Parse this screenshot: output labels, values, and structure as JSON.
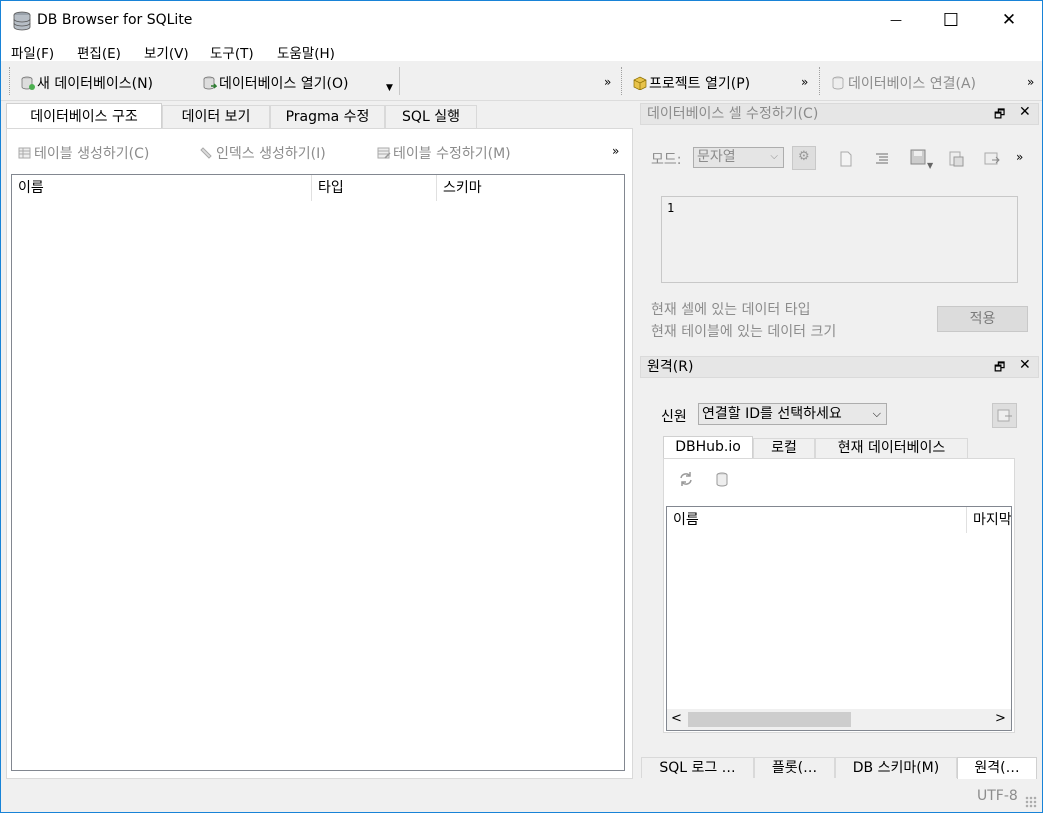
{
  "window": {
    "title": "DB Browser for SQLite",
    "minimize": "—",
    "maximize": "☐",
    "close": "✕"
  },
  "menu": [
    "파일(F)",
    "편집(E)",
    "보기(V)",
    "도구(T)",
    "도움말(H)"
  ],
  "toolbar": {
    "new_db": "새 데이터베이스(N)",
    "open_db": "데이터베이스 열기(O)",
    "open_project": "프로젝트 열기(P)",
    "attach_db": "데이터베이스 연결(A)",
    "more": "»"
  },
  "main_tabs": [
    "데이터베이스 구조",
    "데이터 보기",
    "Pragma 수정",
    "SQL 실행"
  ],
  "structure": {
    "create_table": "테이블 생성하기(C)",
    "create_index": "인덱스 생성하기(I)",
    "modify_table": "테이블 수정하기(M)",
    "more": "»",
    "columns": [
      "이름",
      "타입",
      "스키마"
    ]
  },
  "edit_cell": {
    "title": "데이터베이스 셀 수정하기(C)",
    "mode_label": "모드:",
    "mode_value": "문자열",
    "more": "»",
    "value": "1",
    "type_text": "현재 셀에 있는 데이터 타입",
    "size_text": "현재 테이블에 있는 데이터 크기",
    "apply": "적용"
  },
  "remote": {
    "title": "원격(R)",
    "identity_label": "신원",
    "identity_value": "연결할 ID를 선택하세요",
    "tabs": [
      "DBHub.io",
      "로컬",
      "현재 데이터베이스"
    ],
    "columns": [
      "이름",
      "마지막"
    ],
    "scroll_left": "<",
    "scroll_right": ">"
  },
  "bottom_tabs": [
    "SQL 로그 …",
    "플롯(…",
    "DB 스키마(M)",
    "원격(…"
  ],
  "status": {
    "encoding": "UTF-8"
  }
}
